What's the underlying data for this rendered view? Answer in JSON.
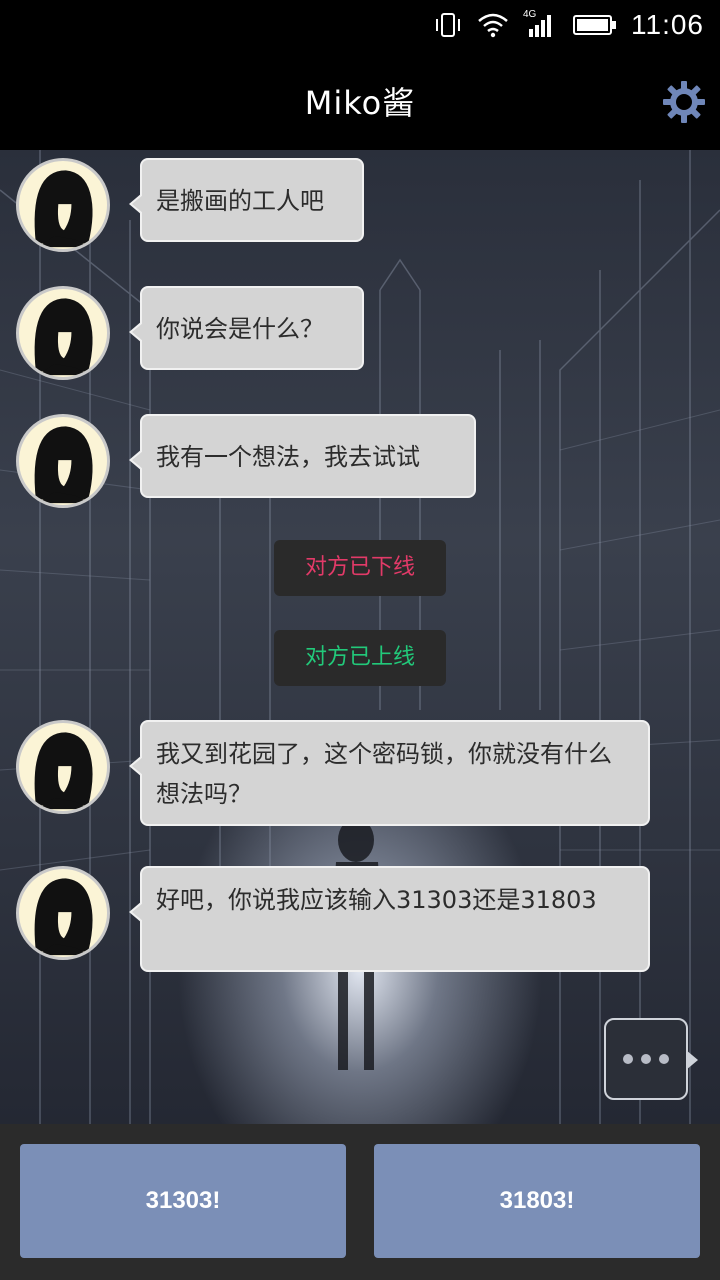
{
  "status_bar": {
    "time": "11:06",
    "network_label": "4G",
    "icons": [
      "vibrate-icon",
      "wifi-icon",
      "cellular-signal-icon",
      "battery-icon"
    ]
  },
  "header": {
    "title": "Miko酱",
    "settings_icon": "gear-icon"
  },
  "messages": [
    {
      "sender": "miko",
      "text": "是搬画的工人吧"
    },
    {
      "sender": "miko",
      "text": "你说会是什么？"
    },
    {
      "sender": "miko",
      "text": "我有一个想法，我去试试"
    },
    {
      "type": "notice",
      "text": "对方已下线",
      "color": "#e23a68"
    },
    {
      "type": "notice",
      "text": "对方已上线",
      "color": "#22c97a"
    },
    {
      "sender": "miko",
      "text": "我又到花园了，这个密码锁，你就没有什么想法吗？"
    },
    {
      "sender": "miko",
      "text": "好吧，你说我应该输入31303还是31803"
    }
  ],
  "typing_indicator": "typing-dots-icon",
  "choices": [
    {
      "label": "31303!"
    },
    {
      "label": "31803!"
    }
  ],
  "colors": {
    "bubble": "#d4d4d4",
    "choice_button": "#7b8fb7",
    "accent_gear": "#6f86b8"
  }
}
